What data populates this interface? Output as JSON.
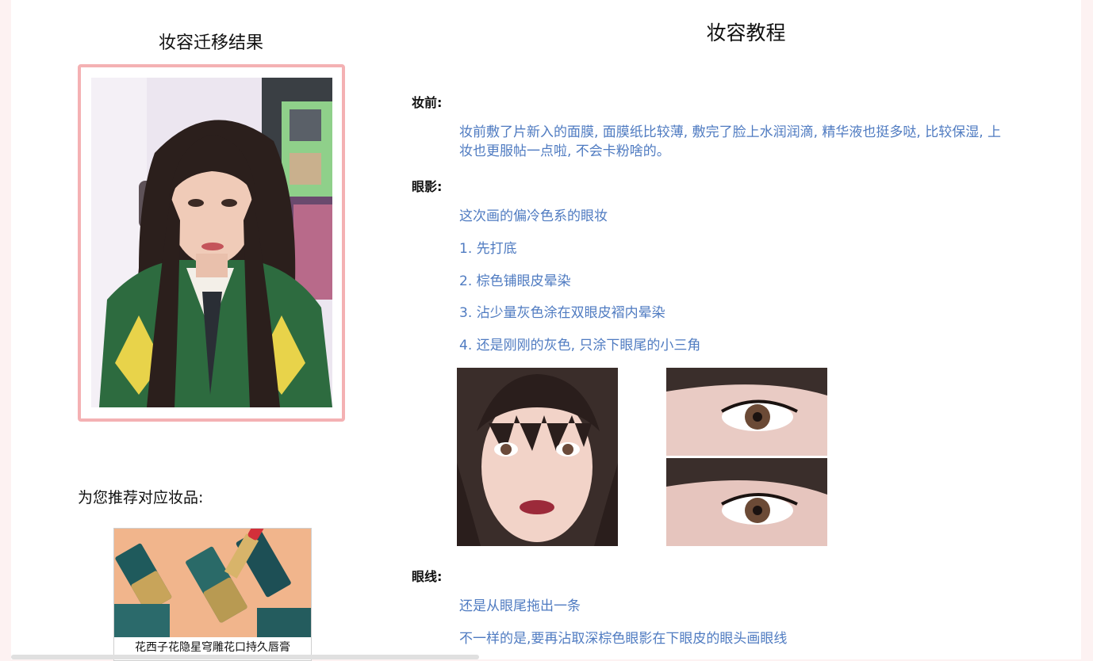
{
  "left_panel": {
    "title": "妆容迁移结果",
    "recommend_label": "为您推荐对应妆品:",
    "product": {
      "name": "花西子花隐星穹雕花口持久唇膏"
    }
  },
  "tutorial": {
    "title": "妆容教程",
    "sections": {
      "before": {
        "heading": "妆前:",
        "text_line1": "妆前敷了片新入的面膜, 面膜纸比较薄, 敷完了脸上水润润滴, 精华液也挺多哒, 比较保湿, 上",
        "text_line2": "妆也更服帖一点啦, 不会卡粉啥的。"
      },
      "eyeshadow": {
        "heading": "眼影:",
        "intro": "这次画的偏冷色系的眼妆",
        "step1": "1. 先打底",
        "step2": "2. 棕色铺眼皮晕染",
        "step3": "3. 沾少量灰色涂在双眼皮褶内晕染",
        "step4": "4. 还是刚刚的灰色, 只涂下眼尾的小三角"
      },
      "eyeliner": {
        "heading": "眼线:",
        "line1": "还是从眼尾拖出一条",
        "line2": "不一样的是,要再沾取深棕色眼影在下眼皮的眼头画眼线"
      }
    }
  },
  "colors": {
    "frame_border": "#f4b1b3",
    "tutorial_text": "#4f7bc1",
    "side_background": "#fdf2f2"
  }
}
